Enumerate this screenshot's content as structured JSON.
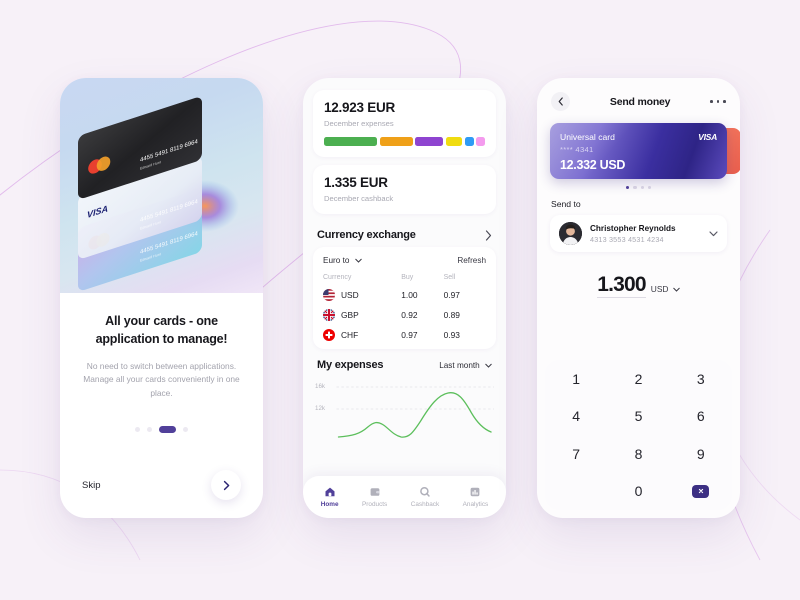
{
  "background": {
    "accent": "#d9a8e8",
    "page_bg": "#f7f1f8"
  },
  "onboarding": {
    "title": "All your cards - one application to manage!",
    "subtitle_line1": "No need to switch between applications.",
    "subtitle_line2": "Manage all your cards conveniently in one place.",
    "skip_label": "Skip",
    "next_icon": "chevron-right-icon",
    "dots": {
      "count": 4,
      "active_index": 2
    },
    "card_numbers": "4455 5491 8119 6964",
    "card_holder": "Edward Hunt",
    "brands": [
      "mastercard",
      "visa",
      "mastercard"
    ]
  },
  "home": {
    "expenses_card": {
      "amount": "12.923 EUR",
      "label": "December expenses",
      "segments": [
        {
          "color": "#4caf50",
          "width": 36
        },
        {
          "color": "#efa018",
          "width": 22
        },
        {
          "color": "#8e44d0",
          "width": 19
        },
        {
          "color": "#f0dc10",
          "width": 11
        },
        {
          "color": "#2f9bf5",
          "width": 6
        },
        {
          "color": "#f49bee",
          "width": 6
        }
      ]
    },
    "cashback_card": {
      "amount": "1.335 EUR",
      "label": "December cashback"
    },
    "exchange": {
      "title": "Currency exchange",
      "chevron_icon": "chevron-right-icon",
      "base_label": "Euro to",
      "refresh_label": "Refresh",
      "headers": [
        "Currency",
        "Buy",
        "Sell"
      ],
      "rows": [
        {
          "flag": "us-flag-icon",
          "code": "USD",
          "buy": "1.00",
          "sell": "0.97"
        },
        {
          "flag": "gb-flag-icon",
          "code": "GBP",
          "buy": "0.92",
          "sell": "0.89"
        },
        {
          "flag": "ch-flag-icon",
          "code": "CHF",
          "buy": "0.97",
          "sell": "0.93"
        }
      ]
    },
    "expenses_chart": {
      "title": "My expenses",
      "period": "Last month",
      "period_icon": "caret-down-icon"
    },
    "nav": [
      {
        "label": "Home",
        "icon": "home-icon",
        "active": true
      },
      {
        "label": "Products",
        "icon": "wallet-icon",
        "active": false
      },
      {
        "label": "Cashback",
        "icon": "coin-icon",
        "active": false
      },
      {
        "label": "Analytics",
        "icon": "chart-icon",
        "active": false
      }
    ]
  },
  "chart_data": {
    "type": "line",
    "title": "My expenses",
    "xlabel": "",
    "ylabel": "",
    "ytick_labels": [
      "16k",
      "12k"
    ],
    "ytick_values": [
      16000,
      12000
    ],
    "ylim": [
      8000,
      18000
    ],
    "grid": true,
    "legend": "none",
    "line_color": "#5cbf5c",
    "series": [
      {
        "name": "Expenses",
        "x": [
          0,
          8,
          16,
          24,
          30,
          36,
          42,
          48,
          52,
          58,
          64,
          70,
          76,
          82,
          88,
          94,
          100
        ],
        "values": [
          8200,
          8300,
          8600,
          9400,
          9900,
          9700,
          9100,
          8500,
          8400,
          10200,
          12600,
          14900,
          15800,
          15900,
          14800,
          12800,
          11600
        ]
      }
    ]
  },
  "send": {
    "header": {
      "title": "Send money",
      "back_icon": "chevron-left-icon",
      "more_icon": "more-horizontal-icon"
    },
    "card": {
      "name": "Universal card",
      "masked": "**** 4341",
      "brand": "VISA",
      "balance": "12.332  USD"
    },
    "card_dots": {
      "count": 4,
      "active_index": 0
    },
    "send_to_label": "Send to",
    "recipient": {
      "name": "Christopher Reynolds",
      "account": "4313 3553 4531 4234",
      "chevron_icon": "chevron-down-icon",
      "avatar": "user-avatar"
    },
    "amount": {
      "value": "1.300",
      "currency": "USD",
      "currency_icon": "caret-down-icon"
    },
    "keypad": [
      "1",
      "2",
      "3",
      "4",
      "5",
      "6",
      "7",
      "8",
      "9",
      "",
      "0",
      "backspace"
    ],
    "backspace_icon": "backspace-icon"
  }
}
